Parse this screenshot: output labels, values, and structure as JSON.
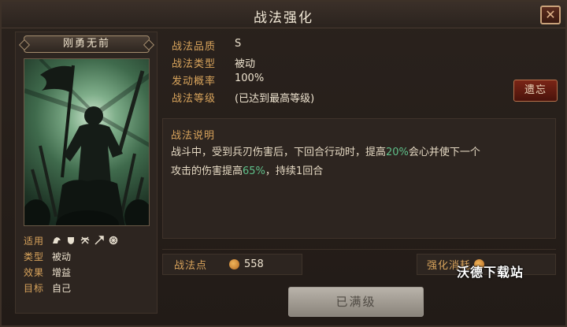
{
  "window": {
    "title": "战法强化",
    "close_glyph": "✕"
  },
  "card": {
    "name": "刚勇无前",
    "attributes": {
      "applicable_label": "适用",
      "type_label": "类型",
      "type_value": "被动",
      "effect_label": "效果",
      "effect_value": "增益",
      "target_label": "目标",
      "target_value": "自己",
      "troop_icons": [
        "cavalry-icon",
        "shield-icon",
        "crossbow-icon",
        "spear-icon",
        "siege-icon"
      ]
    }
  },
  "info": {
    "quality_label": "战法品质",
    "quality_value": "S",
    "type_label": "战法类型",
    "type_value": "被动",
    "rate_label": "发动概率",
    "rate_value": "100%",
    "level_label": "战法等级",
    "level_value": "(已达到最高等级)"
  },
  "forget_button": "遗忘",
  "description": {
    "title": "战法说明",
    "text_1": "战斗中，受到兵刃伤害后，下回合行动时，提高",
    "value_1": "20%",
    "text_2": "会心并使下一个",
    "text_3": "攻击的伤害提高",
    "value_2": "65%",
    "text_4": "，持续1回合"
  },
  "points": {
    "label": "战法点",
    "value": "558"
  },
  "cost": {
    "label": "强化消耗"
  },
  "watermark": "沃德下载站",
  "maxed_button": "已满级",
  "colors": {
    "label_gold": "#d9a45c",
    "highlight_green": "#5fc08a",
    "forget_red": "#7a2516"
  }
}
